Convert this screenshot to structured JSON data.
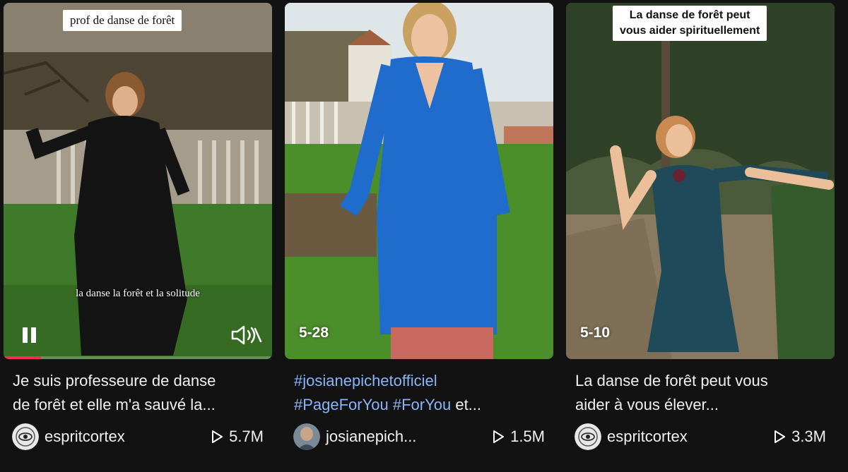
{
  "videos": [
    {
      "overlay_text": "prof de danse de forêt",
      "subtitle": "la danse la forêt et la solitude",
      "progress_fraction": 0.14,
      "description_line1": "Je suis professeure de danse",
      "description_line2": "de forêt et elle m'a sauvé la...",
      "username": "espritcortex",
      "views": "5.7M"
    },
    {
      "date": "5-28",
      "description_line1": "#josianepichetofficiel",
      "description_line2_tags": "#PageForYou #ForYou",
      "description_line2_rest": " et...",
      "username": "josianepich...",
      "views": "1.5M"
    },
    {
      "overlay_text_line1": "La danse de forêt peut",
      "overlay_text_line2": "vous aider spirituellement",
      "date": "5-10",
      "description_line1": "La danse de forêt peut vous",
      "description_line2": "aider à vous élever...",
      "username": "espritcortex",
      "views": "3.3M"
    }
  ],
  "icons": {
    "pause": "pause-icon",
    "volume": "volume-muted-icon",
    "play": "play-icon"
  },
  "colors": {
    "background": "#121212",
    "progress": "#fe2c55",
    "hashtag": "#8ab4f8"
  }
}
